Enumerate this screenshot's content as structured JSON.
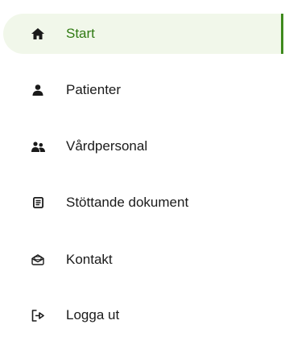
{
  "colors": {
    "accent": "#3f8a1e",
    "active_background": "#f1f7ea",
    "text": "#1a1a1a"
  },
  "menu": {
    "items": [
      {
        "label": "Start",
        "icon": "home-icon",
        "active": true
      },
      {
        "label": "Patienter",
        "icon": "person-icon",
        "active": false
      },
      {
        "label": "Vårdpersonal",
        "icon": "people-icon",
        "active": false
      },
      {
        "label": "Stöttande dokument",
        "icon": "document-icon",
        "active": false
      },
      {
        "label": "Kontakt",
        "icon": "mail-icon",
        "active": false
      },
      {
        "label": "Logga ut",
        "icon": "logout-icon",
        "active": false
      }
    ]
  }
}
